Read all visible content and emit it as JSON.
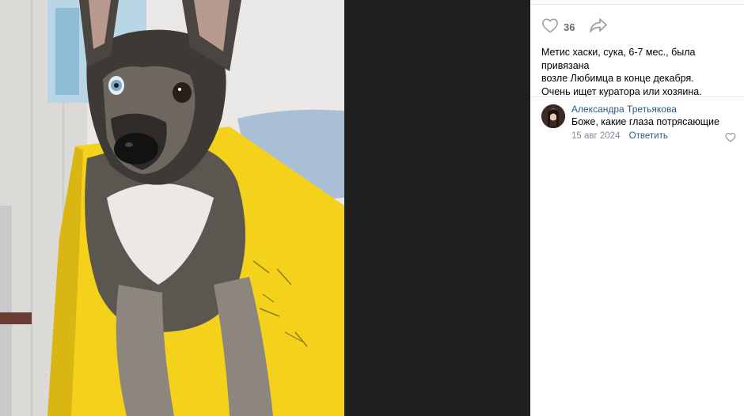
{
  "post": {
    "likes_count": "36",
    "like_icon": "heart-outline-icon",
    "share_icon": "share-arrow-icon",
    "text_lines": [
      "Метис хаски, сука, 6-7 мес., была привязана",
      "возле Любимца в конце декабря.",
      "Очень ищет куратора или хозяина."
    ]
  },
  "comment": {
    "author": "Александра Третьякова",
    "text": "Боже, какие глаза потрясающие",
    "date": "15 авг 2024",
    "reply_label": "Ответить",
    "like_icon": "heart-outline-icon"
  },
  "colors": {
    "link": "#2a5885",
    "muted": "#818c99",
    "icon": "#99a2ad",
    "backdrop": "#1f1f1f",
    "table_yellow": "#f4d21c"
  }
}
